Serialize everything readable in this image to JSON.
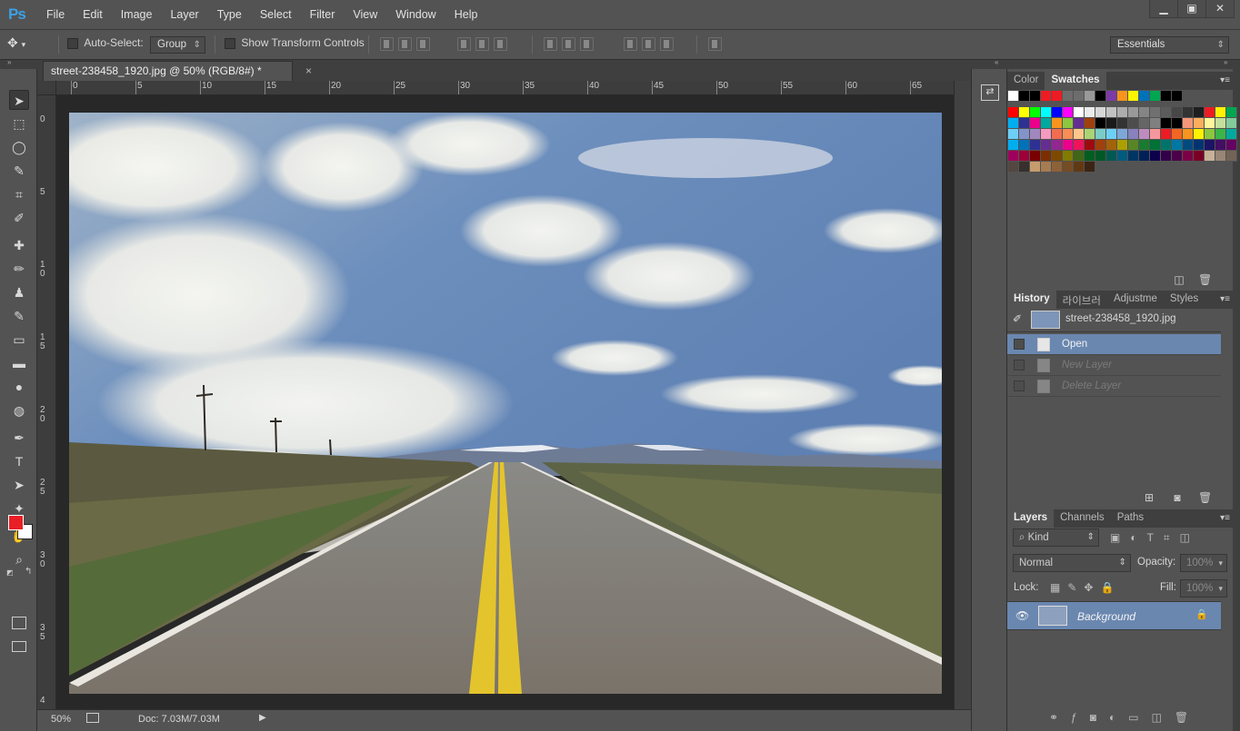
{
  "app": {
    "logo": "Ps"
  },
  "menu": [
    "File",
    "Edit",
    "Image",
    "Layer",
    "Type",
    "Select",
    "Filter",
    "View",
    "Window",
    "Help"
  ],
  "window_controls": {
    "minimize": "▁",
    "restore": "▣",
    "close": "✕"
  },
  "options_bar": {
    "auto_select_label": "Auto-Select:",
    "auto_select_value": "Group",
    "transform_label": "Show Transform Controls",
    "workspace": "Essentials"
  },
  "document": {
    "tab_title": "street-238458_1920.jpg @ 50% (RGB/8#) *",
    "close": "×",
    "ruler_h": [
      "0",
      "5",
      "10",
      "15",
      "20",
      "25",
      "30",
      "35",
      "40",
      "45",
      "50",
      "55",
      "60",
      "65"
    ],
    "ruler_v": [
      "0",
      "5",
      "10",
      "15",
      "20",
      "25",
      "30",
      "35",
      "4"
    ],
    "zoom": "50%",
    "doc_size": "Doc: 7.03M/7.03M",
    "status_arrow": "▶"
  },
  "tools": [
    "move-tool",
    "marquee-tool",
    "lasso-tool",
    "quick-select-tool",
    "crop-tool",
    "eyedropper-tool",
    "healing-tool",
    "brush-tool",
    "stamp-tool",
    "history-brush-tool",
    "eraser-tool",
    "gradient-tool",
    "blur-tool",
    "dodge-tool",
    "pen-tool",
    "type-tool",
    "path-select-tool",
    "shape-tool",
    "hand-tool",
    "zoom-tool"
  ],
  "tool_glyphs": [
    "➤",
    "⬚",
    "◯",
    "✎",
    "⌗",
    "✐",
    "✚",
    "✏",
    "♟",
    "✎",
    "▭",
    "▬",
    "●",
    "◍",
    "✒",
    "T",
    "➤",
    "✦",
    "✋",
    "⌕"
  ],
  "colors": {
    "foreground": "#ea1f25",
    "background": "#ffffff",
    "accent": "#6a87b0"
  },
  "color_panel": {
    "tabs": [
      "Color",
      "Swatches"
    ]
  },
  "history_panel": {
    "tabs": [
      "History",
      "라이브러",
      "Adjustme",
      "Styles"
    ],
    "snapshot": "street-238458_1920.jpg",
    "items": [
      {
        "label": "Open",
        "state": "selected"
      },
      {
        "label": "New Layer",
        "state": "undone"
      },
      {
        "label": "Delete Layer",
        "state": "undone"
      }
    ]
  },
  "layers_panel": {
    "tabs": [
      "Layers",
      "Channels",
      "Paths"
    ],
    "filter_kind": "Kind",
    "blend_mode": "Normal",
    "opacity_label": "Opacity:",
    "opacity_value": "100%",
    "lock_label": "Lock:",
    "fill_label": "Fill:",
    "fill_value": "100%",
    "layers": [
      {
        "name": "Background",
        "visible": true,
        "locked": true
      }
    ]
  }
}
